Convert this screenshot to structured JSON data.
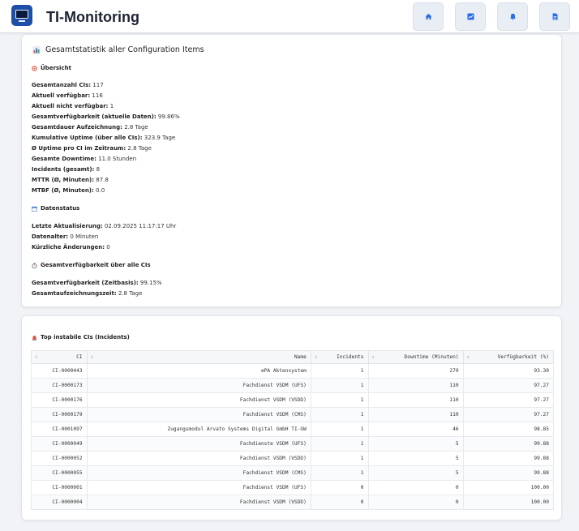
{
  "app": {
    "title": "TI-Monitoring"
  },
  "nav": [
    "home-icon",
    "chart-icon",
    "bell-icon",
    "document-icon"
  ],
  "stats": {
    "title": "Gesamtstatistik aller Configuration Items",
    "overview_heading": "Übersicht",
    "overview": [
      {
        "label": "Gesamtanzahl CIs:",
        "value": "117"
      },
      {
        "label": "Aktuell verfügbar:",
        "value": "116"
      },
      {
        "label": "Aktuell nicht verfügbar:",
        "value": "1"
      },
      {
        "label": "Gesamtverfügbarkeit (aktuelle Daten):",
        "value": "99.86%"
      },
      {
        "label": "Gesamtdauer Aufzeichnung:",
        "value": "2.8 Tage"
      },
      {
        "label": "Kumulative Uptime (über alle CIs):",
        "value": "323.9 Tage"
      },
      {
        "label": "Ø Uptime pro CI im Zeitraum:",
        "value": "2.8 Tage"
      },
      {
        "label": "Gesamte Downtime:",
        "value": "11.0 Stunden"
      },
      {
        "label": "Incidents (gesamt):",
        "value": "8"
      },
      {
        "label": "MTTR (Ø, Minuten):",
        "value": "87.8"
      },
      {
        "label": "MTBF (Ø, Minuten):",
        "value": "0.0"
      }
    ],
    "datastatus_heading": "Datenstatus",
    "datastatus": [
      {
        "label": "Letzte Aktualisierung:",
        "value": "02.09.2025 11:17:17 Uhr"
      },
      {
        "label": "Datenalter:",
        "value": "0 Minuten"
      },
      {
        "label": "Kürzliche Änderungen:",
        "value": "0"
      }
    ],
    "availability_heading": "Gesamtverfügbarkeit über alle CIs",
    "availability": [
      {
        "label": "Gesamtverfügbarkeit (Zeitbasis):",
        "value": "99.15%"
      },
      {
        "label": "Gesamtaufzeichnungszeit:",
        "value": "2.8 Tage"
      }
    ]
  },
  "unstable": {
    "heading": "Top instabile CIs (Incidents)",
    "columns": [
      "CI",
      "Name",
      "Incidents",
      "Downtime (Minuten)",
      "Verfügbarkeit (%)"
    ],
    "rows": [
      [
        "CI-0000443",
        "ePA Aktensystem",
        "1",
        "270",
        "93.30"
      ],
      [
        "CI-0000173",
        "Fachdienst VSDM (UFS)",
        "1",
        "110",
        "97.27"
      ],
      [
        "CI-0000176",
        "Fachdienst VSDM (VSDD)",
        "1",
        "110",
        "97.27"
      ],
      [
        "CI-0000179",
        "Fachdienst VSDM (CMS)",
        "1",
        "110",
        "97.27"
      ],
      [
        "CI-0001097",
        "Zugangsmodul Arvato Systems Digital GmbH TI-GW",
        "1",
        "46",
        "98.85"
      ],
      [
        "CI-0000049",
        "Fachdienste VSDM (UFS)",
        "1",
        "5",
        "99.88"
      ],
      [
        "CI-0000052",
        "Fachdienst VSDM (VSDD)",
        "1",
        "5",
        "99.88"
      ],
      [
        "CI-0000055",
        "Fachdienst VSDM (CMS)",
        "1",
        "5",
        "99.88"
      ],
      [
        "CI-0000001",
        "Fachdienst VSDM (UFS)",
        "0",
        "0",
        "100.00"
      ],
      [
        "CI-0000004",
        "Fachdienst VSDM (VSDD)",
        "0",
        "0",
        "100.00"
      ]
    ]
  }
}
